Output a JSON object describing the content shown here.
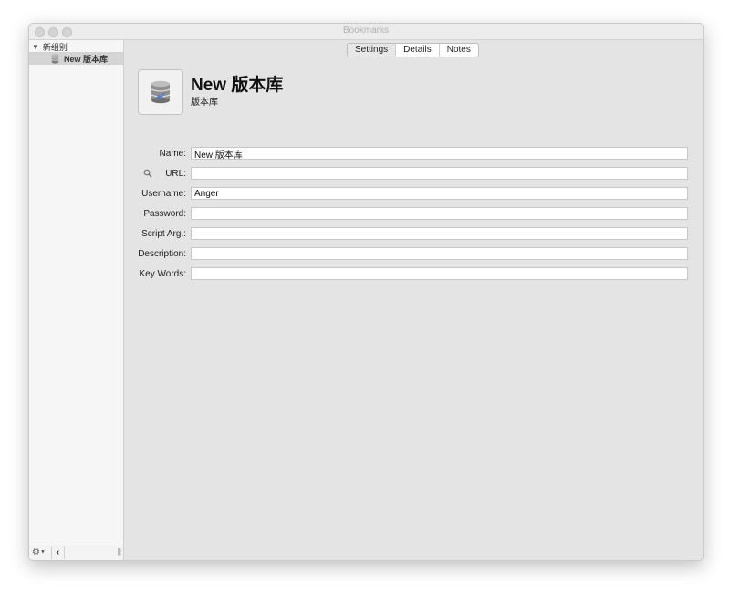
{
  "window": {
    "title": "Bookmarks"
  },
  "sidebar": {
    "group": {
      "label": "新组别"
    },
    "items": [
      {
        "label": "New 版本库",
        "icon": "database-icon"
      }
    ],
    "footer": {
      "gear_icon": "gear-icon",
      "back_icon": "chevron-left-icon",
      "resize_icon": "resize-handle-icon",
      "back_glyph": "‹",
      "resize_glyph": "|||"
    }
  },
  "tabs": [
    {
      "label": "Settings",
      "active": true
    },
    {
      "label": "Details",
      "active": false
    },
    {
      "label": "Notes",
      "active": false
    }
  ],
  "record": {
    "title": "New 版本库",
    "subtitle": "版本库",
    "icon": "database-icon"
  },
  "form": {
    "name": {
      "label": "Name:",
      "value": "New 版本库"
    },
    "url": {
      "label": "URL:",
      "value": ""
    },
    "username": {
      "label": "Username:",
      "value": "Anger"
    },
    "password": {
      "label": "Password:",
      "value": ""
    },
    "script_arg": {
      "label": "Script Arg.:",
      "value": ""
    },
    "description": {
      "label": "Description:",
      "value": ""
    },
    "key_words": {
      "label": "Key Words:",
      "value": ""
    }
  },
  "colors": {
    "window_bg": "#e4e4e4",
    "sidebar_bg": "#f6f6f6",
    "selection": "#d4d4d4",
    "db_icon_accent": "#4a7bd0"
  }
}
